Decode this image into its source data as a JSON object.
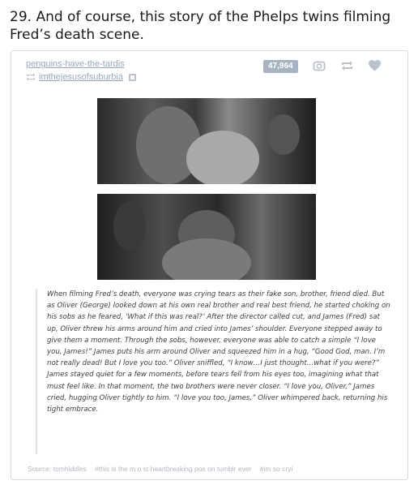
{
  "headline": "29. And of course, this story of the Phelps twins filming Fred’s death scene.",
  "post": {
    "blog_name": "penguins-have-the-tardis",
    "reblogged_from": "imthejesusofsuburbia",
    "notes_count": "47,964",
    "icons": [
      "reblog-icon",
      "camera-icon",
      "reblog-arrows-icon",
      "heart-icon"
    ]
  },
  "quote_text": "When filming Fred’s death, everyone was crying tears as their fake son, brother, friend died. But as Oliver (George) looked down at his own real brother and real best friend, he started choking on his sobs as he feared, ‘What if this was real?’ After the director called cut, and James (Fred) sat up, Oliver threw his arms around him and cried into James’ shoulder. Everyone stepped away to give them a moment. Through the sobs, however, everyone was able to catch a simple “I love you, James!” James puts his arm around Oliver and squeezed him in a hug, “Good God, man. I’m not really dead! But I love you too.” Oliver sniffled, “I know…I just thought…what if you were?” James stayed quiet for a few moments, before tears fell from his eyes too, imagining what that must feel like. In that moment, the two brothers were never closer. “I love you, Oliver,” James cried, hugging Oliver tightly to him. “I love you too, James,” Oliver whimpered back, returning his tight embrace.",
  "footer": {
    "source": "Source: tomhiddles",
    "tags": [
      "#this is the m o st heartbreaking pos on tumblr ever",
      "#im so cryi"
    ]
  },
  "colors": {
    "link": "#9aa7b6",
    "badge": "#a7b3c0",
    "icon": "#b8c1cc"
  }
}
